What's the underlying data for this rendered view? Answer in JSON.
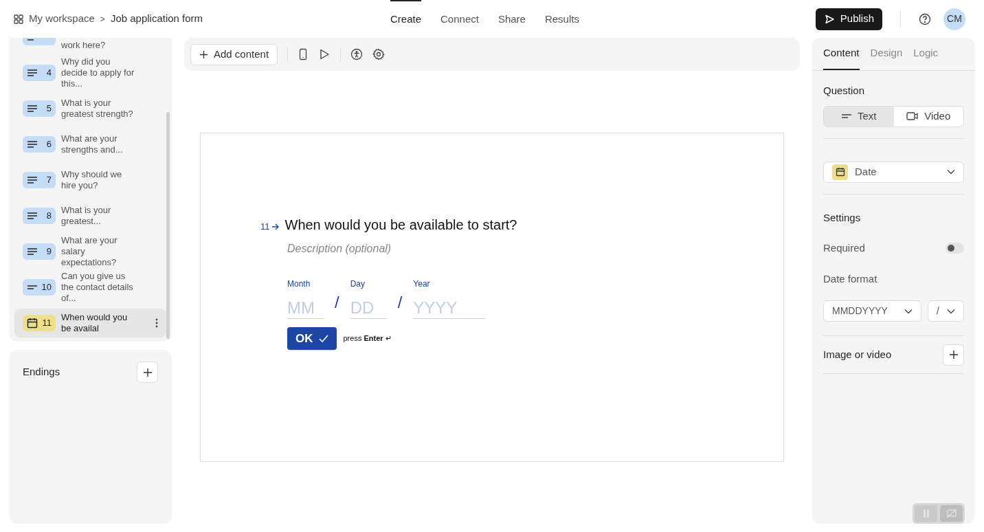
{
  "breadcrumb": {
    "workspace": "My workspace",
    "separator": ">",
    "form": "Job application form"
  },
  "nav_tabs": [
    {
      "label": "Create",
      "selected": true
    },
    {
      "label": "Connect",
      "selected": false
    },
    {
      "label": "Share",
      "selected": false
    },
    {
      "label": "Results",
      "selected": false
    }
  ],
  "publish_button": "Publish",
  "avatar": "CM",
  "questions": [
    {
      "kind": "long_text",
      "title": "work here?",
      "selected": false
    },
    {
      "kind": "long_text",
      "number": "4",
      "title": "Why did you decide to apply for this...",
      "selected": false
    },
    {
      "kind": "long_text",
      "number": "5",
      "title": "What is your greatest strength?",
      "selected": false
    },
    {
      "kind": "long_text",
      "number": "6",
      "title": "What are your strengths and...",
      "selected": false
    },
    {
      "kind": "long_text",
      "number": "7",
      "title": "Why should we hire you?",
      "selected": false
    },
    {
      "kind": "long_text",
      "number": "8",
      "title": "What is your greatest...",
      "selected": false
    },
    {
      "kind": "long_text",
      "number": "9",
      "title": "What are your salary expectations?",
      "selected": false
    },
    {
      "kind": "short_text",
      "number": "10",
      "title": "Can you give us the contact details of...",
      "selected": false
    },
    {
      "kind": "date",
      "number": "11",
      "title": "When would you be availal",
      "selected": true
    }
  ],
  "endings": {
    "title": "Endings"
  },
  "toolbar": {
    "add_content": "Add content"
  },
  "question": {
    "number": "11",
    "title": "When would you be available to start?",
    "description_placeholder": "Description (optional)",
    "date_fields": [
      {
        "label": "Month",
        "placeholder": "MM"
      },
      {
        "label": "Day",
        "placeholder": "DD"
      },
      {
        "label": "Year",
        "placeholder": "YYYY"
      }
    ],
    "separator": "/",
    "ok_button": "OK",
    "hint_prefix": "press",
    "hint_key": "Enter",
    "hint_icon": "↵"
  },
  "panel_tabs": [
    {
      "label": "Content",
      "selected": true
    },
    {
      "label": "Design",
      "selected": false
    },
    {
      "label": "Logic",
      "selected": false
    }
  ],
  "panel": {
    "question_label": "Question",
    "question_modes": [
      {
        "kind": "text",
        "label": "Text",
        "selected": true
      },
      {
        "kind": "video",
        "label": "Video",
        "selected": false
      }
    ],
    "type_select": "Date",
    "settings_label": "Settings",
    "required_label": "Required",
    "required_on": false,
    "date_format_label": "Date format",
    "date_format": "MMDDYYYY",
    "separator_select": "/",
    "media_label": "Image or video"
  }
}
